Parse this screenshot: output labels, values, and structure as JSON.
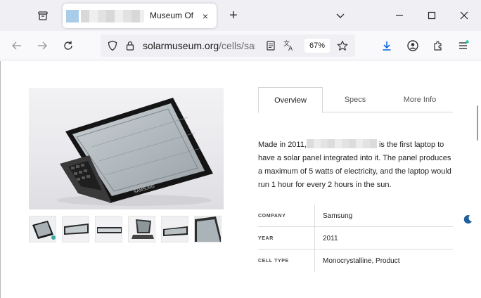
{
  "browser": {
    "tab": {
      "title": "Museum Of",
      "close_glyph": "×"
    },
    "new_tab_glyph": "+",
    "url": {
      "host": "solarmuseum.org",
      "path": "/cells/sam"
    },
    "zoom": "67%",
    "accent_color": "#0060df",
    "extension_dot_color": "#2ac3a2"
  },
  "page": {
    "tabs": [
      {
        "label": "Overview"
      },
      {
        "label": "Specs"
      },
      {
        "label": "More Info"
      }
    ],
    "description": {
      "before": "Made in 2011,",
      "after": " is the first laptop to have a solar panel integrated into it. The panel produces a maximum of 5 watts of electricity, and the laptop would run 1 hour for every 2 hours in the sun."
    },
    "specs": [
      {
        "key": "COMPANY",
        "value": "Samsung"
      },
      {
        "key": "YEAR",
        "value": "2011"
      },
      {
        "key": "CELL TYPE",
        "value": "Monocrystalline, Product"
      }
    ],
    "image_brand_text": "SAMSUNG"
  }
}
